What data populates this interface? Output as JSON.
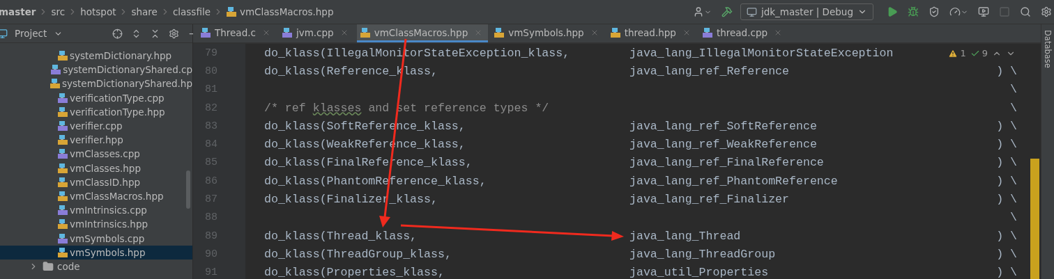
{
  "breadcrumb": [
    {
      "label": "master",
      "kind": "project"
    },
    {
      "label": "src",
      "kind": "folder"
    },
    {
      "label": "hotspot",
      "kind": "folder"
    },
    {
      "label": "share",
      "kind": "folder"
    },
    {
      "label": "classfile",
      "kind": "folder"
    },
    {
      "label": "vmClassMacros.hpp",
      "kind": "hpp"
    }
  ],
  "toolbar": {
    "run_config": "jdk_master | Debug",
    "buttons": [
      {
        "kind": "user",
        "disabled": false
      },
      {
        "kind": "build",
        "disabled": false
      },
      {
        "kind": "config"
      },
      {
        "kind": "run",
        "disabled": false
      },
      {
        "kind": "debug",
        "disabled": false
      },
      {
        "kind": "coverage",
        "disabled": false
      },
      {
        "kind": "profile",
        "disabled": false
      },
      {
        "kind": "attach",
        "disabled": false
      },
      {
        "kind": "stop",
        "disabled": true
      },
      {
        "kind": "search",
        "disabled": false
      },
      {
        "kind": "settings",
        "disabled": false
      }
    ]
  },
  "project_panel": {
    "title": "Project",
    "tree": [
      {
        "children": [
          {
            "label": "systemDictionary.hpp",
            "kind": "hpp",
            "selected": false
          },
          {
            "label": "systemDictionaryShared.cp",
            "kind": "cpp",
            "selected": false
          },
          {
            "label": "systemDictionaryShared.hp",
            "kind": "hpp",
            "selected": false
          },
          {
            "label": "verificationType.cpp",
            "kind": "cpp",
            "selected": false
          },
          {
            "label": "verificationType.hpp",
            "kind": "hpp",
            "selected": false
          },
          {
            "label": "verifier.cpp",
            "kind": "cpp",
            "selected": false
          },
          {
            "label": "verifier.hpp",
            "kind": "hpp",
            "selected": false
          },
          {
            "label": "vmClasses.cpp",
            "kind": "cpp",
            "selected": false
          },
          {
            "label": "vmClasses.hpp",
            "kind": "hpp",
            "selected": false
          },
          {
            "label": "vmClassID.hpp",
            "kind": "hpp",
            "selected": false
          },
          {
            "label": "vmClassMacros.hpp",
            "kind": "hpp",
            "selected": false
          },
          {
            "label": "vmIntrinsics.cpp",
            "kind": "cpp",
            "selected": false
          },
          {
            "label": "vmIntrinsics.hpp",
            "kind": "hpp",
            "selected": false
          },
          {
            "label": "vmSymbols.cpp",
            "kind": "cpp",
            "selected": false
          },
          {
            "label": "vmSymbols.hpp",
            "kind": "hpp",
            "selected": true
          }
        ]
      },
      {
        "label": "code",
        "kind": "folder",
        "expanded": false,
        "selected": false
      }
    ]
  },
  "tabs": [
    {
      "label": "Thread.c",
      "kind": "c",
      "selected": false
    },
    {
      "label": "jvm.cpp",
      "kind": "cpp",
      "selected": false
    },
    {
      "label": "vmClassMacros.hpp",
      "kind": "hpp",
      "selected": true
    },
    {
      "label": "vmSymbols.hpp",
      "kind": "hpp",
      "selected": false
    },
    {
      "label": "thread.hpp",
      "kind": "hpp",
      "selected": false
    },
    {
      "label": "thread.cpp",
      "kind": "cpp",
      "selected": false
    }
  ],
  "editor": {
    "inspections": {
      "warnings": "1",
      "weak_warnings": "9"
    },
    "lines": [
      {
        "number": "79",
        "kind": "code",
        "code": [
          {
            "text": "do_klass(IllegalMonitorStateException_klass,"
          }
        ],
        "target": "java_lang_IllegalMonitorStateException"
      },
      {
        "number": "80",
        "kind": "code",
        "code": [
          {
            "text": "do_klass(Reference_klass,"
          }
        ],
        "target": "java_lang_ref_Reference",
        "tail": ") \\"
      },
      {
        "number": "81",
        "tail": "\\"
      },
      {
        "number": "82",
        "kind": "comment",
        "code": [
          {
            "text": "/* ref ",
            "typo": false
          },
          {
            "text": "klasses",
            "typo": true
          },
          {
            "text": " and set reference types */",
            "typo": false
          }
        ],
        "tail": "\\"
      },
      {
        "number": "83",
        "kind": "code",
        "code": [
          {
            "text": "do_klass(SoftReference_klass,"
          }
        ],
        "target": "java_lang_ref_SoftReference",
        "tail": ") \\"
      },
      {
        "number": "84",
        "kind": "code",
        "code": [
          {
            "text": "do_klass(WeakReference_klass,"
          }
        ],
        "target": "java_lang_ref_WeakReference",
        "tail": ") \\"
      },
      {
        "number": "85",
        "kind": "code",
        "code": [
          {
            "text": "do_klass(FinalReference_klass,"
          }
        ],
        "target": "java_lang_ref_FinalReference",
        "tail": ") \\"
      },
      {
        "number": "86",
        "kind": "code",
        "code": [
          {
            "text": "do_klass(PhantomReference_klass,"
          }
        ],
        "target": "java_lang_ref_PhantomReference",
        "tail": ") \\"
      },
      {
        "number": "87",
        "kind": "code",
        "code": [
          {
            "text": "do_klass(Finalizer_klass,"
          }
        ],
        "target": "java_lang_ref_Finalizer",
        "tail": ") \\"
      },
      {
        "number": "88",
        "tail": "\\"
      },
      {
        "number": "89",
        "kind": "code",
        "code": [
          {
            "text": "do_klass(Thread_klass,"
          }
        ],
        "target": "java_lang_Thread",
        "tail": ") \\"
      },
      {
        "number": "90",
        "kind": "code",
        "code": [
          {
            "text": "do_klass(ThreadGroup_klass,"
          }
        ],
        "target": "java_lang_ThreadGroup",
        "tail": ") \\"
      },
      {
        "number": "91",
        "kind": "code",
        "code": [
          {
            "text": "do_klass(Properties_klass,"
          }
        ],
        "target": "java_util_Properties",
        "tail": ") \\"
      }
    ]
  },
  "side_panel": {
    "label": "Database"
  }
}
